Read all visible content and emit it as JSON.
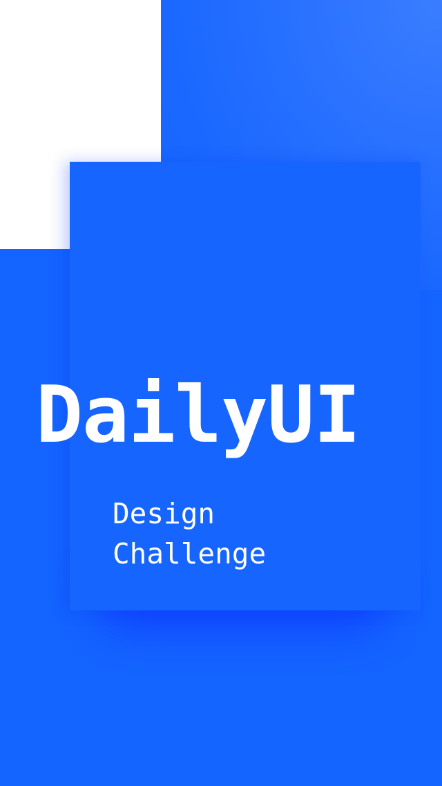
{
  "title": "DailyUI",
  "subtitle": {
    "line1": "Design",
    "line2": "Challenge"
  },
  "colors": {
    "background": "#1464ff",
    "card": "#1765ff",
    "white_block": "#ffffff",
    "text": "#ffffff"
  }
}
